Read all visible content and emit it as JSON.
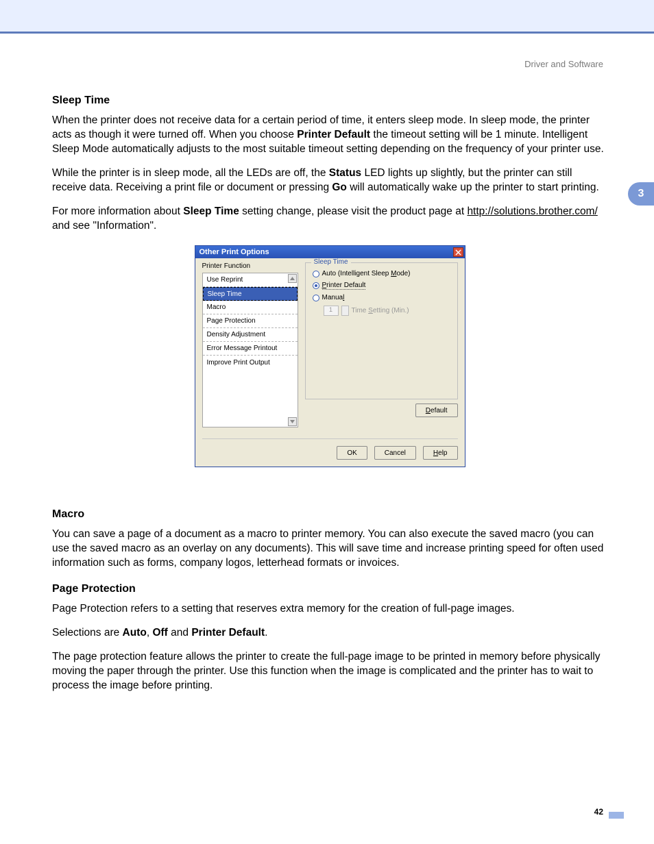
{
  "header": {
    "section": "Driver and Software",
    "chapter": "3"
  },
  "page_number": "42",
  "sleep_time": {
    "heading": "Sleep Time",
    "p1a": "When the printer does not receive data for a certain period of time, it enters sleep mode. In sleep mode, the printer acts as though it were turned off. When you choose ",
    "p1_bold1": "Printer Default",
    "p1b": " the timeout setting will be 1 minute. Intelligent Sleep Mode automatically adjusts to the most suitable timeout setting depending on the frequency of your printer use.",
    "p2a": "While the printer is in sleep mode, all the LEDs are off, the ",
    "p2_bold1": "Status",
    "p2b": " LED lights up slightly, but the printer can still receive data. Receiving a print file or document or pressing ",
    "p2_bold2": "Go",
    "p2c": " will automatically wake up the printer to start printing.",
    "p3a": "For more information about ",
    "p3_bold1": "Sleep Time",
    "p3b": " setting change, please visit the product page at ",
    "p3_link": "http://solutions.brother.com/",
    "p3c": " and see \"Information\"."
  },
  "macro": {
    "heading": "Macro",
    "p1": "You can save a page of a document as a macro to printer memory. You can also execute the saved macro (you can use the saved macro as an overlay on any documents). This will save time and increase printing speed for often used information such as forms, company logos, letterhead formats or invoices."
  },
  "page_protection": {
    "heading": "Page Protection",
    "p1": "Page Protection refers to a setting that reserves extra memory for the creation of full-page images.",
    "p2a": "Selections are ",
    "p2_b1": "Auto",
    "p2_s1": ", ",
    "p2_b2": "Off",
    "p2_s2": " and ",
    "p2_b3": "Printer Default",
    "p2_s3": ".",
    "p3": "The page protection feature allows the printer to create the full-page image to be printed in memory before physically moving the paper through the printer. Use this function when the image is complicated and the printer has to wait to process the image before printing."
  },
  "dialog": {
    "title": "Other Print Options",
    "printer_function_label": "Printer Function",
    "list": {
      "use_reprint": "Use Reprint",
      "sleep_time": "Sleep Time",
      "macro": "Macro",
      "page_protection": "Page Protection",
      "density_adjustment": "Density Adjustment",
      "error_message_printout": "Error Message Printout",
      "improve_print_output": "Improve Print Output"
    },
    "group_legend": "Sleep Time",
    "radio_auto_a": "Auto (Intelligent Sleep ",
    "radio_auto_m": "M",
    "radio_auto_b": "ode)",
    "radio_pd_p": "P",
    "radio_pd_rest": "rinter Default",
    "radio_manual_a": "Manua",
    "radio_manual_l": "l",
    "spin_value": "1",
    "spin_label_a": "Time ",
    "spin_label_s": "S",
    "spin_label_b": "etting (Min.)",
    "default_btn_d": "D",
    "default_btn_rest": "efault",
    "ok": "OK",
    "cancel": "Cancel",
    "help_h": "H",
    "help_rest": "elp"
  }
}
